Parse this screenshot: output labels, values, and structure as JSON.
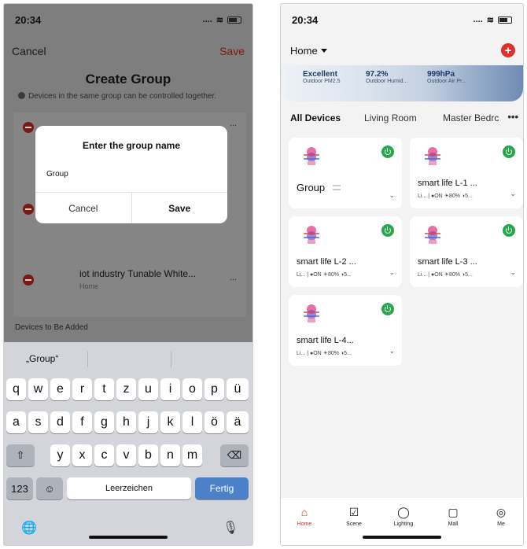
{
  "left_phone": {
    "status": {
      "time": "20:34",
      "signal": "...."
    },
    "top_bar": {
      "cancel": "Cancel",
      "save": "Save"
    },
    "title": "Create Group",
    "info": "Devices in the same group can be controlled together.",
    "group_devices": [
      {
        "name": "iot industry Tunable White...",
        "room": "Home",
        "more": "..."
      }
    ],
    "row_more": "...",
    "devices_to_add_label": "Devices to Be Added",
    "dialog": {
      "title": "Enter the group name",
      "input_value": "Group",
      "cancel": "Cancel",
      "save": "Save"
    },
    "keyboard": {
      "suggestion": "„Group“",
      "row1": [
        "q",
        "w",
        "e",
        "r",
        "t",
        "z",
        "u",
        "i",
        "o",
        "p",
        "ü"
      ],
      "row2": [
        "a",
        "s",
        "d",
        "f",
        "g",
        "h",
        "j",
        "k",
        "l",
        "ö",
        "ä"
      ],
      "row3": [
        "y",
        "x",
        "c",
        "v",
        "b",
        "n",
        "m"
      ],
      "shift": "⇧",
      "backspace": "⌫",
      "numbers": "123",
      "emoji": "☺",
      "space": "Leerzeichen",
      "done": "Fertig",
      "globe": "🌐",
      "mic": "🎙"
    }
  },
  "right_phone": {
    "status": {
      "time": "20:34",
      "signal": "...."
    },
    "home_selector": "Home",
    "add_button": "+",
    "weather": [
      {
        "value": "Excellent",
        "label": "Outdoor PM2.5"
      },
      {
        "value": "97.2%",
        "label": "Outdoor Humid..."
      },
      {
        "value": "999hPa",
        "label": "Outdoor Air Pr..."
      }
    ],
    "tabs": [
      "All Devices",
      "Living Room",
      "Master Bedrc"
    ],
    "tabs_more": "•••",
    "devices": [
      {
        "name": "Group",
        "status": ""
      },
      {
        "name": "smart life L-1 ...",
        "status": "Li...  |  ●ON  ☀80%  ◑5..."
      },
      {
        "name": "smart life L-2 ...",
        "status": "Li...  |  ●ON  ☀80%  ◑5..."
      },
      {
        "name": "smart life L-3 ...",
        "status": "Li...  |  ●ON  ☀80%  ◑5..."
      },
      {
        "name": "smart life  L-4...",
        "status": "Li...  |  ●ON  ☀80%  ◑5..."
      }
    ],
    "chevron": "⌄",
    "nav": [
      {
        "label": "Home",
        "icon": "home-icon"
      },
      {
        "label": "Scene",
        "icon": "scene-icon"
      },
      {
        "label": "Lighting",
        "icon": "lighting-icon"
      },
      {
        "label": "Mall",
        "icon": "mall-icon"
      },
      {
        "label": "Me",
        "icon": "me-icon"
      }
    ],
    "colors": {
      "accent": "#e0302a",
      "power_on": "#25a84a"
    }
  }
}
